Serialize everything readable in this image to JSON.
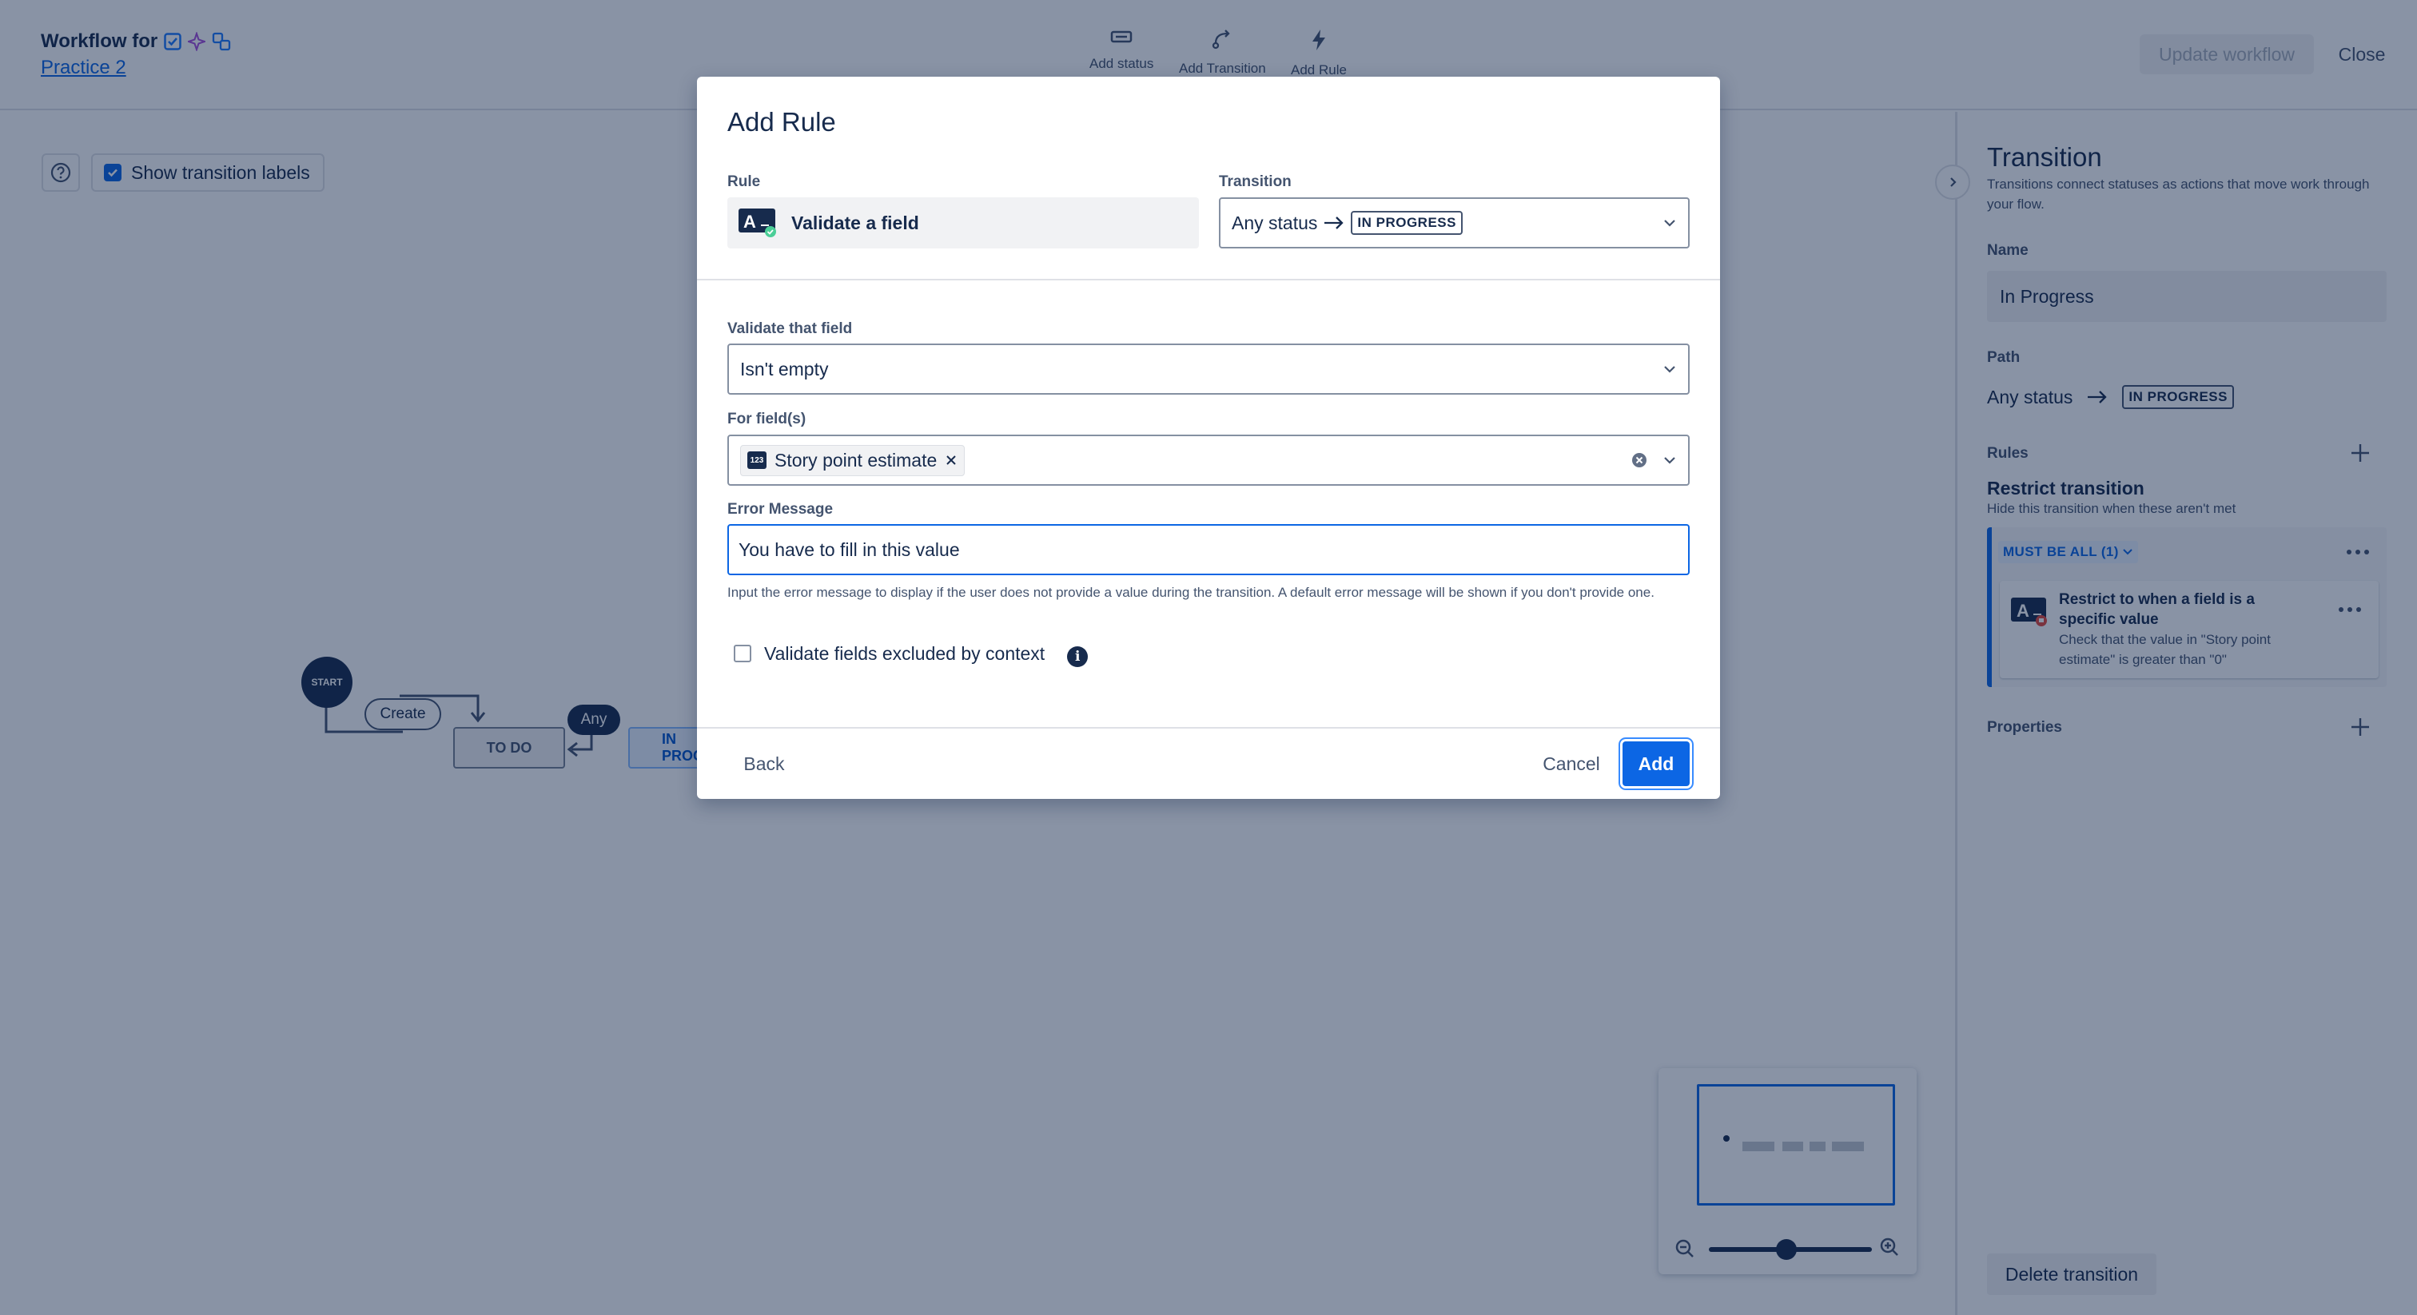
{
  "header": {
    "title": "Workflow for",
    "project_link": "Practice 2",
    "tools": [
      {
        "label": "Add status",
        "icon": "status-icon"
      },
      {
        "label": "Add Transition",
        "icon": "transition-icon"
      },
      {
        "label": "Add Rule",
        "icon": "bolt-icon"
      }
    ],
    "update_label": "Update workflow",
    "close_label": "Close"
  },
  "canvas": {
    "show_labels": "Show transition labels",
    "start_label": "START",
    "create_label": "Create",
    "todo_label": "TO DO",
    "any_label": "Any",
    "inprogress_label": "IN PROGRESS"
  },
  "panel": {
    "title": "Transition",
    "description": "Transitions connect statuses as actions that move work through your flow.",
    "name_label": "Name",
    "name_value": "In Progress",
    "path_label": "Path",
    "path_from": "Any status",
    "path_to": "IN PROGRESS",
    "rules_label": "Rules",
    "restrict_title": "Restrict transition",
    "restrict_desc": "Hide this transition when these aren't met",
    "must_be_all": "MUST BE ALL (1)",
    "rule_card_title": "Restrict to when a field is a specific value",
    "rule_card_desc": "Check that the value in \"Story point estimate\" is greater than \"0\"",
    "properties_label": "Properties",
    "delete_label": "Delete transition"
  },
  "modal": {
    "title": "Add Rule",
    "rule_label": "Rule",
    "rule_value": "Validate a field",
    "transition_label": "Transition",
    "transition_from": "Any status",
    "transition_to": "IN PROGRESS",
    "validate_label": "Validate that field",
    "validate_value": "Isn't empty",
    "fields_label": "For field(s)",
    "field_chip": "Story point estimate",
    "field_chip_icon": "123",
    "error_label": "Error Message",
    "error_value": "You have to fill in this value",
    "error_helper": "Input the error message to display if the user does not provide a value during the transition. A default error message will be shown if you don't provide one.",
    "excluded_label": "Validate fields excluded by context",
    "back_label": "Back",
    "cancel_label": "Cancel",
    "add_label": "Add"
  },
  "colors": {
    "primary": "#0c66e4",
    "text": "#172b4d",
    "subtle_text": "#44546f",
    "overlay": "rgba(9,30,66,0.48)"
  }
}
